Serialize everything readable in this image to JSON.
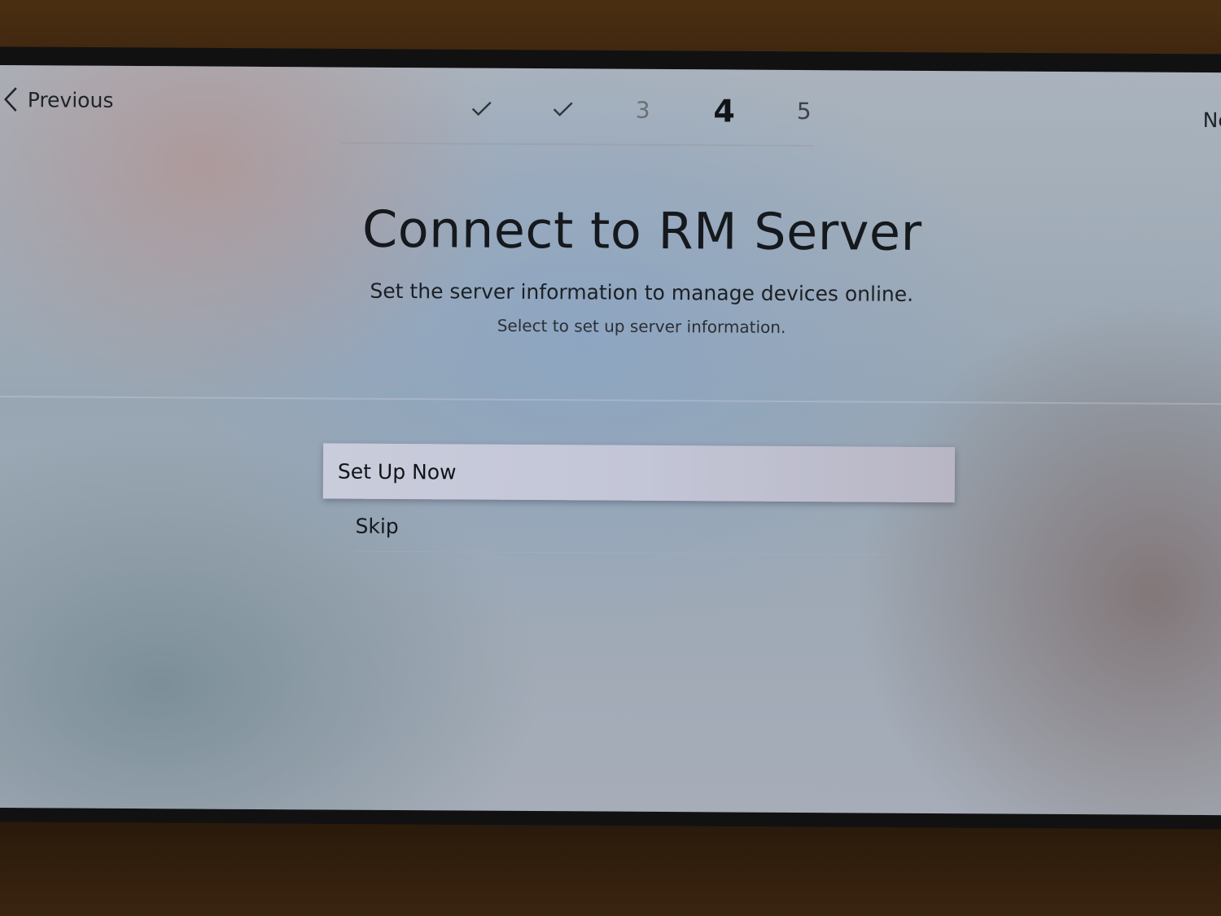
{
  "nav": {
    "previous_label": "Previous",
    "next_label_partial": "Ne"
  },
  "steps": [
    {
      "state": "done",
      "icon": "checkmark-icon"
    },
    {
      "state": "done",
      "icon": "checkmark-icon"
    },
    {
      "state": "pending",
      "label": "3"
    },
    {
      "state": "current",
      "label": "4"
    },
    {
      "state": "pending",
      "label": "5"
    }
  ],
  "page": {
    "title": "Connect to RM Server",
    "subtitle": "Set the server information to manage devices online.",
    "hint": "Select to set up server information."
  },
  "options": {
    "set_up_now": "Set Up Now",
    "skip": "Skip"
  },
  "colors": {
    "focus_bg": "#c6c9d8",
    "text": "#15191d"
  }
}
